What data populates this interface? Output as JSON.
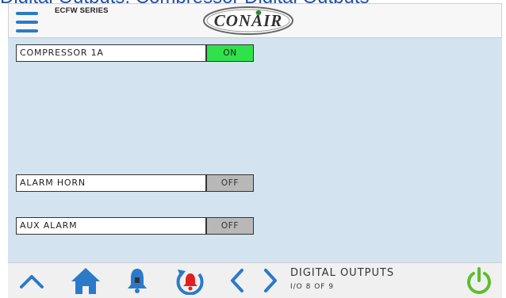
{
  "caption": "Digital Outputs, Compressor Digital Outputs",
  "header": {
    "series_label": "ECFW SERIES",
    "logo_text": "CONAIR"
  },
  "outputs": [
    {
      "label": "COMPRESSOR 1A",
      "state": "ON"
    },
    {
      "label": "ALARM HORN",
      "state": "OFF"
    },
    {
      "label": "AUX ALARM",
      "state": "OFF"
    }
  ],
  "footer": {
    "page_title": "DIGITAL OUTPUTS",
    "page_subtitle": "I/O 8 OF 9"
  },
  "colors": {
    "accent_blue": "#2b7ac9",
    "on_green": "#2fe14a",
    "off_gray": "#b8b8b8",
    "alarm_red": "#e02020",
    "power_green": "#5cbf2a",
    "content_bg": "#d3e3ef"
  },
  "icons": [
    "menu-icon",
    "conair-logo",
    "chevron-up-icon",
    "home-icon",
    "bell-icon",
    "alarm-reset-icon",
    "chevron-left-icon",
    "chevron-right-icon",
    "power-icon"
  ]
}
